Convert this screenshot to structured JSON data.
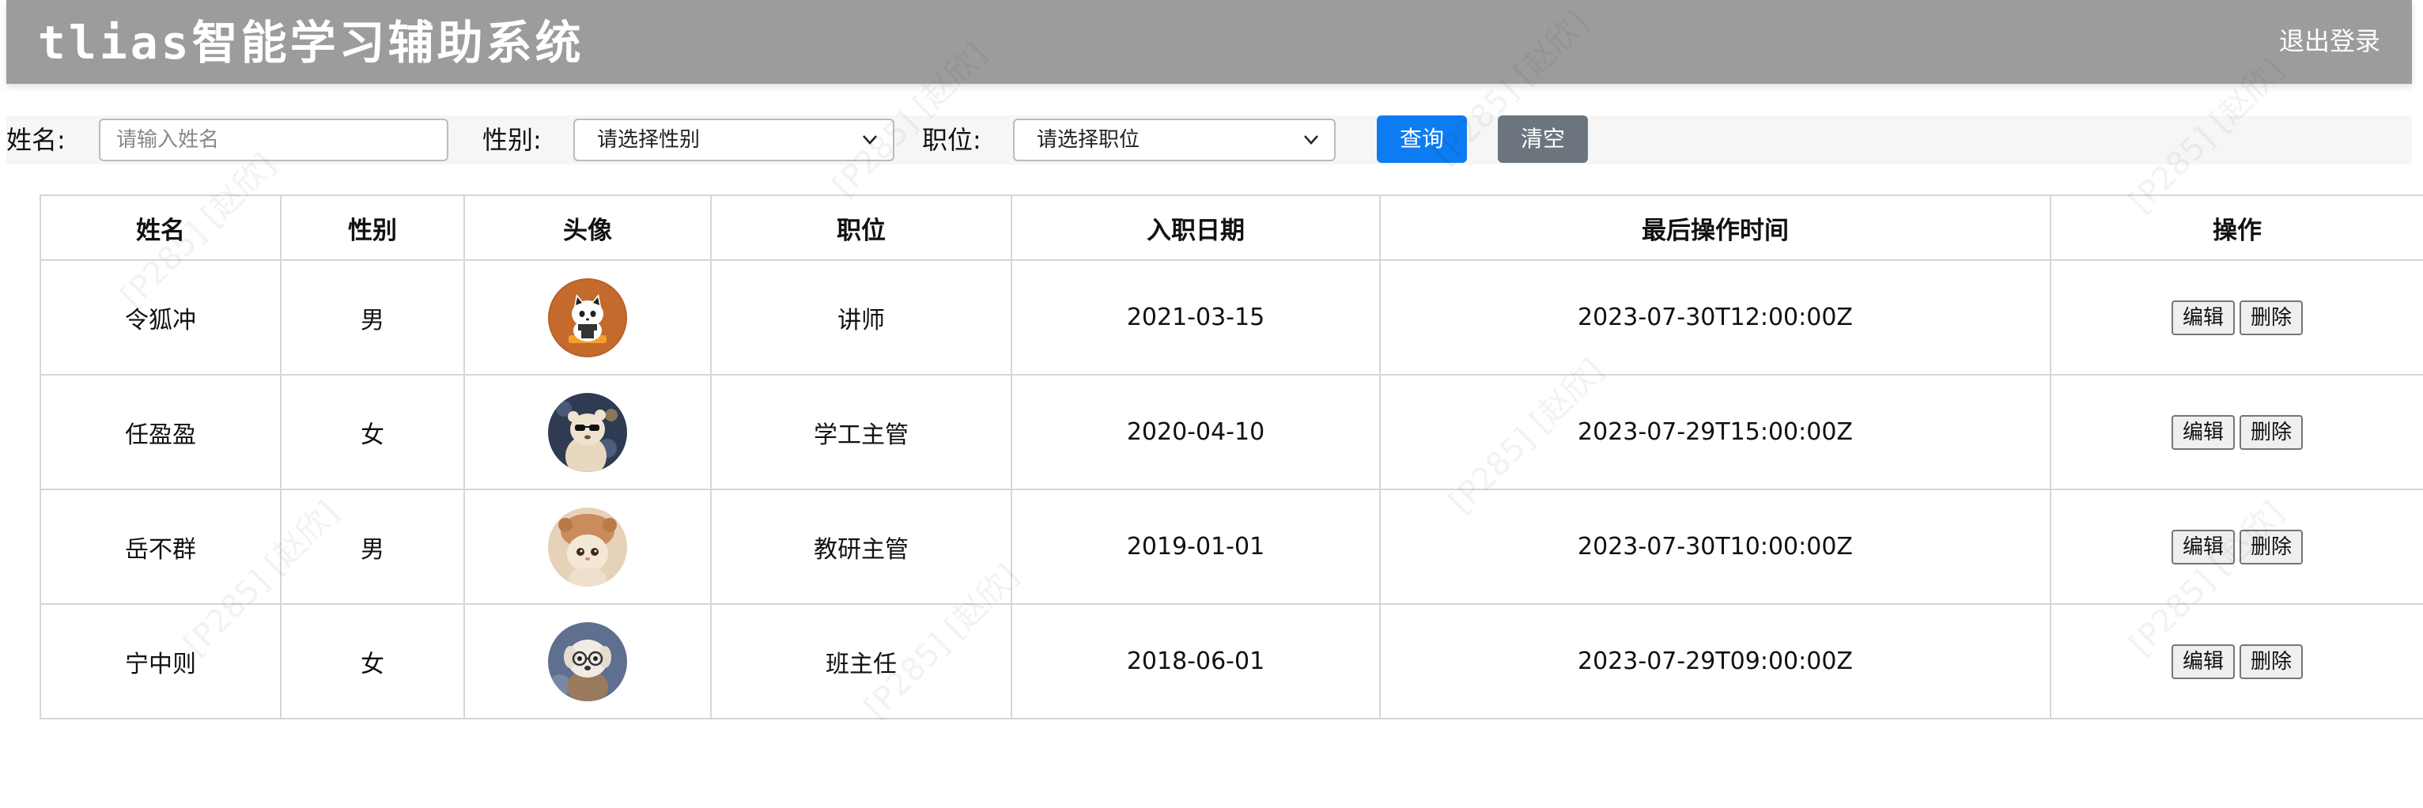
{
  "header": {
    "title": "tlias智能学习辅助系统",
    "logout_label": "退出登录"
  },
  "search": {
    "name_label": "姓名:",
    "name_placeholder": "请输入姓名",
    "name_value": "",
    "gender_label": "性别:",
    "gender_selected": "请选择性别",
    "position_label": "职位:",
    "position_selected": "请选择职位",
    "query_label": "查询",
    "clear_label": "清空"
  },
  "table": {
    "columns": [
      "姓名",
      "性别",
      "头像",
      "职位",
      "入职日期",
      "最后操作时间",
      "操作"
    ],
    "rows": [
      {
        "name": "令狐冲",
        "gender": "男",
        "avatar": "cat-avatar",
        "position": "讲师",
        "entry_date": "2021-03-15",
        "update_time": "2023-07-30T12:00:00Z"
      },
      {
        "name": "任盈盈",
        "gender": "女",
        "avatar": "bear-sunglasses-avatar",
        "position": "学工主管",
        "entry_date": "2020-04-10",
        "update_time": "2023-07-29T15:00:00Z"
      },
      {
        "name": "岳不群",
        "gender": "男",
        "avatar": "kitten-hat-avatar",
        "position": "教研主管",
        "entry_date": "2019-01-01",
        "update_time": "2023-07-30T10:00:00Z"
      },
      {
        "name": "宁中则",
        "gender": "女",
        "avatar": "puppy-glasses-avatar",
        "position": "班主任",
        "entry_date": "2018-06-01",
        "update_time": "2023-07-29T09:00:00Z"
      }
    ],
    "edit_label": "编辑",
    "delete_label": "删除"
  },
  "watermark_text": "[P285] [赵欣]",
  "colors": {
    "header_bg": "#9c9c9b",
    "primary": "#0d7cf2",
    "secondary": "#6c757d"
  }
}
